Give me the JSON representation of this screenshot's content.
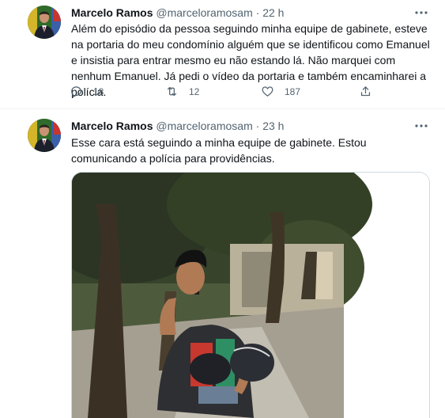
{
  "tweets": [
    {
      "name": "Marcelo Ramos",
      "handle": "@marceloramosam",
      "separator": "·",
      "time": "22 h",
      "text": "Além do episódio da pessoa seguindo minha equipe de gabinete, esteve na portaria do meu condomínio alguém que se identificou como Emanuel e insistia para entrar mesmo eu não estando lá. Não marquei com nenhum Emanuel. Já pedi o vídeo da portaria e também encaminharei a polícia.",
      "replies": "18",
      "retweets": "12",
      "likes": "187"
    },
    {
      "name": "Marcelo Ramos",
      "handle": "@marceloramosam",
      "separator": "·",
      "time": "23 h",
      "text": "Esse cara está seguindo a minha equipe de gabinete. Estou comunicando a polícia para providências."
    }
  ],
  "icons": {
    "more": "more-dots-icon",
    "reply": "reply-icon",
    "retweet": "retweet-icon",
    "like": "heart-icon",
    "share": "share-icon"
  },
  "colors": {
    "text": "#0f1419",
    "secondary": "#536471",
    "divider": "#eff3f4",
    "media_border": "#cfd9de"
  }
}
